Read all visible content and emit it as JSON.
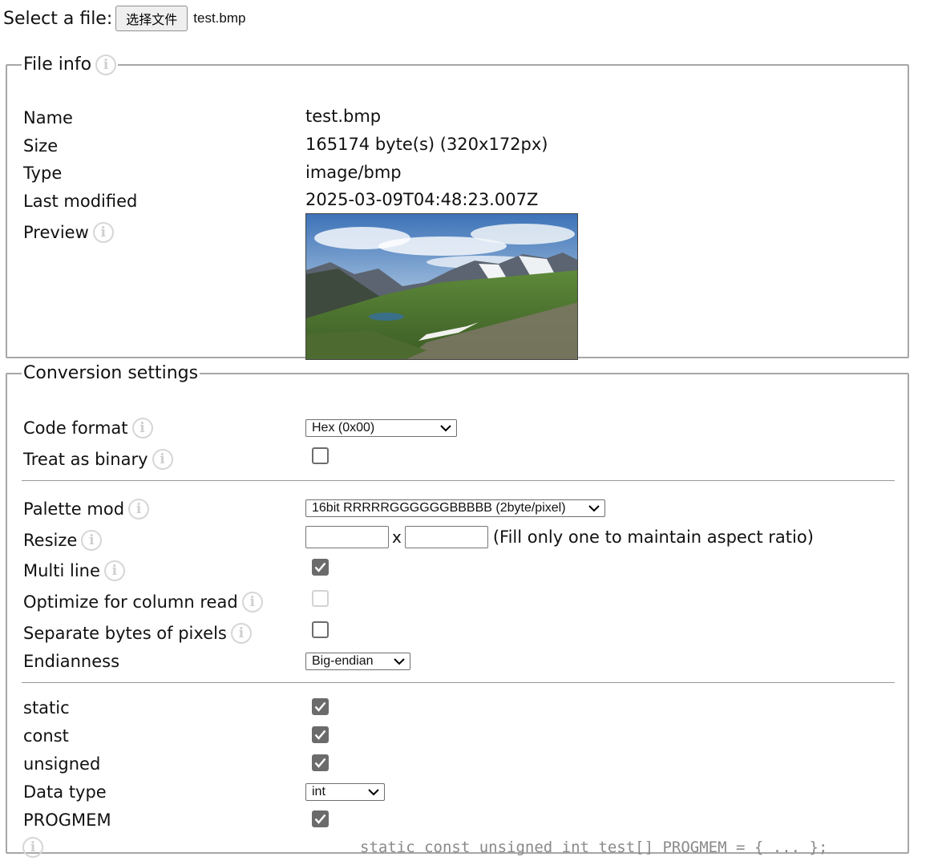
{
  "file_picker": {
    "label": "Select a file:",
    "button_label": "选择文件",
    "selected_file": "test.bmp"
  },
  "file_info": {
    "legend": "File info",
    "name_label": "Name",
    "name_value": "test.bmp",
    "size_label": "Size",
    "size_value": "165174 byte(s) (320x172px)",
    "type_label": "Type",
    "type_value": "image/bmp",
    "modified_label": "Last modified",
    "modified_value": "2025-03-09T04:48:23.007Z",
    "preview_label": "Preview"
  },
  "conversion": {
    "legend": "Conversion settings",
    "code_format_label": "Code format",
    "code_format_value": "Hex (0x00)",
    "treat_binary_label": "Treat as binary",
    "treat_binary_checked": false,
    "palette_label": "Palette mod",
    "palette_value": "16bit RRRRRGGGGGGBBBBB (2byte/pixel)",
    "resize_label": "Resize",
    "resize_width": "",
    "resize_height": "",
    "resize_x": "x",
    "resize_hint": "(Fill only one to maintain aspect ratio)",
    "multiline_label": "Multi line",
    "multiline_checked": true,
    "optimize_label": "Optimize for column read",
    "optimize_checked": false,
    "optimize_disabled": true,
    "separate_label": "Separate bytes of pixels",
    "separate_checked": false,
    "endianness_label": "Endianness",
    "endianness_value": "Big-endian",
    "static_label": "static",
    "static_checked": true,
    "const_label": "const",
    "const_checked": true,
    "unsigned_label": "unsigned",
    "unsigned_checked": true,
    "datatype_label": "Data type",
    "datatype_value": "int",
    "progmem_label": "PROGMEM",
    "progmem_checked": true,
    "code_preview": "static const unsigned int test[] PROGMEM = { ... };"
  },
  "icons": {
    "info": "info-icon",
    "check": "check-icon",
    "dropdown": "chevron-down-icon"
  }
}
